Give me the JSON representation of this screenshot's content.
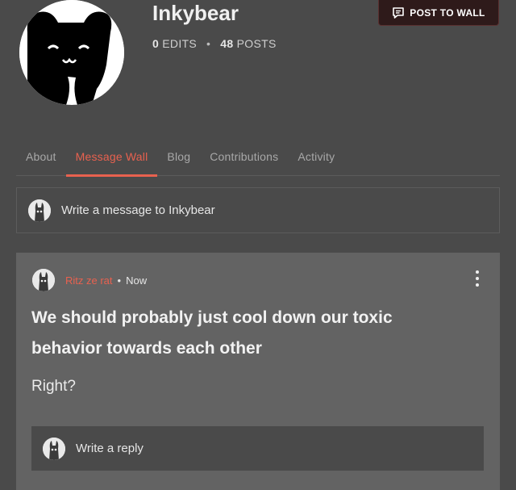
{
  "profile": {
    "username": "Inkybear",
    "edits_count": "0",
    "edits_label": "EDITS",
    "posts_count": "48",
    "posts_label": "POSTS",
    "separator": "•"
  },
  "header": {
    "post_button_label": "POST TO WALL",
    "post_button_icon": "message-bubble-icon"
  },
  "tabs": [
    {
      "label": "About",
      "active": false
    },
    {
      "label": "Message Wall",
      "active": true
    },
    {
      "label": "Blog",
      "active": false
    },
    {
      "label": "Contributions",
      "active": false
    },
    {
      "label": "Activity",
      "active": false
    }
  ],
  "compose": {
    "placeholder": "Write a message to Inkybear"
  },
  "post": {
    "author": "Ritz ze rat",
    "separator": "•",
    "time": "Now",
    "title": "We should probably just cool down our toxic behavior towards each other",
    "body": "Right?",
    "reply_placeholder": "Write a reply"
  },
  "colors": {
    "background": "#4a4a4a",
    "card": "#636363",
    "accent": "#e8614f",
    "post_button_bg": "#2e1a1a"
  }
}
